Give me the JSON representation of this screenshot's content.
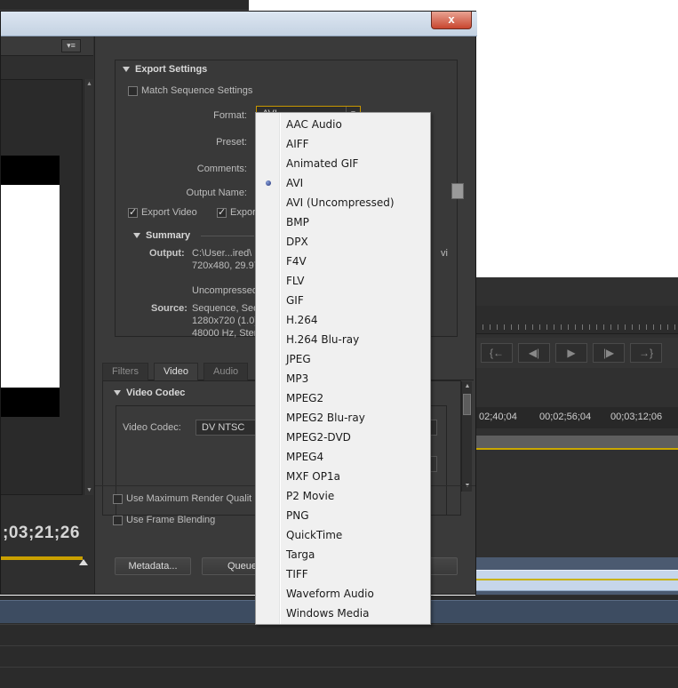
{
  "background": {
    "timeline_times": [
      "02;40;04",
      "00;02;56;04",
      "00;03;12;06"
    ],
    "transport_glyphs": [
      "{←",
      "◀|",
      "▶",
      "|▶",
      "→}"
    ]
  },
  "dialog": {
    "close_label": "x",
    "left": {
      "menu_glyph": "▾≡",
      "timecode": ";03;21;26"
    },
    "export_settings": {
      "title": "Export Settings",
      "match_sequence": "Match Sequence Settings",
      "format_label": "Format:",
      "format_value": "AVI",
      "preset_label": "Preset:",
      "comments_label": "Comments:",
      "output_name_label": "Output Name:",
      "export_video": "Export Video",
      "export_audio_partial": "Expor",
      "summary": {
        "title": "Summary",
        "output_label": "Output:",
        "output_line1": "C:\\User...ired\\",
        "output_line1_tail": "vi",
        "output_line2": "720x480, 29.97",
        "output_line3": "Uncompressed",
        "source_label": "Source:",
        "source_line1": "Sequence, Seq",
        "source_line2": "1280x720 (1.0)",
        "source_line3": "48000 Hz, Ster"
      }
    },
    "tabs": [
      "Filters",
      "Video",
      "Audio"
    ],
    "active_tab": "Video",
    "video_codec": {
      "title": "Video Codec",
      "label": "Video Codec:",
      "value": "DV NTSC"
    },
    "options": {
      "max_render_quality": "Use Maximum Render Qualit",
      "frame_blending": "Use Frame Blending"
    },
    "buttons": {
      "metadata": "Metadata...",
      "queue": "Queue"
    }
  },
  "format_dropdown": {
    "selected": "AVI",
    "items": [
      "AAC Audio",
      "AIFF",
      "Animated GIF",
      "AVI",
      "AVI (Uncompressed)",
      "BMP",
      "DPX",
      "F4V",
      "FLV",
      "GIF",
      "H.264",
      "H.264 Blu-ray",
      "JPEG",
      "MP3",
      "MPEG2",
      "MPEG2 Blu-ray",
      "MPEG2-DVD",
      "MPEG4",
      "MXF OP1a",
      "P2 Movie",
      "PNG",
      "QuickTime",
      "Targa",
      "TIFF",
      "Waveform Audio",
      "Windows Media"
    ]
  }
}
